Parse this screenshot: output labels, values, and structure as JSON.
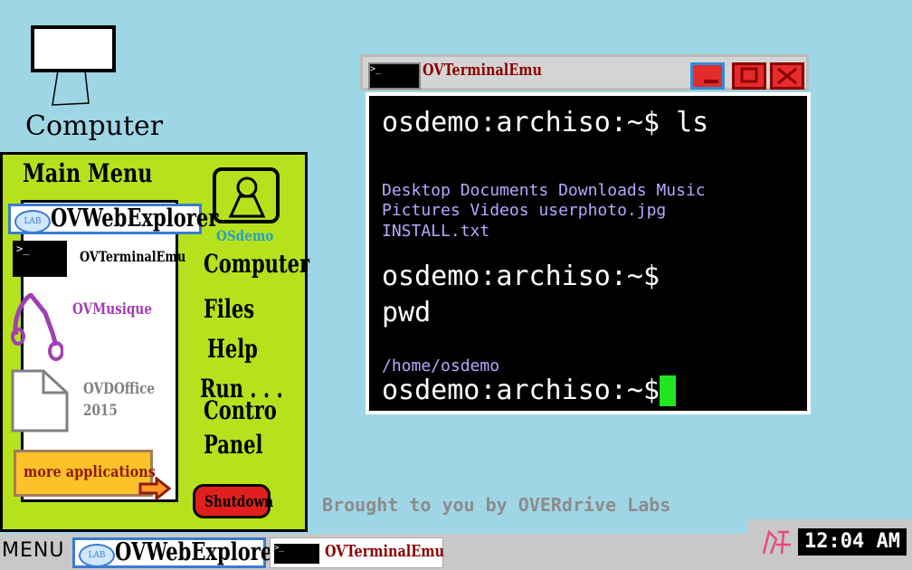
{
  "desktop": {
    "computer_label": "Computer"
  },
  "main_menu": {
    "title": "Main Menu",
    "pinned_app": "OVWebExplorer",
    "apps": [
      {
        "label": "OVTerminalEmu",
        "icon": "terminal-icon",
        "color": "#000000"
      },
      {
        "label": "OVMusique",
        "icon": "music-note-icon",
        "color": "#a040b0"
      },
      {
        "label_line1": "OVDOffice",
        "label_line2": "2015",
        "icon": "document-icon",
        "color": "#808080"
      }
    ],
    "more_apps": "more applications",
    "os_name": "OSdemo",
    "nav": [
      "Computer",
      "Files",
      "Help",
      "Run . . .",
      "Contro",
      "Panel"
    ],
    "shutdown": "Shutdown"
  },
  "terminal": {
    "title": "OVTerminalEmu",
    "icon_text": ">_",
    "lines": [
      "osdemo:archiso:~$ ls",
      "Desktop Documents Downloads Music",
      "Pictures Videos userphoto.jpg",
      "INSTALL.txt",
      "osdemo:archiso:~$",
      "pwd",
      "/home/osdemo",
      "osdemo:archiso:~$"
    ]
  },
  "credit": "Brought to you by OVERdrive Labs",
  "taskbar": {
    "start": "MENU",
    "tasks": [
      "OVWebExplorer",
      "OVTerminalEmu"
    ],
    "clock": "12:04 AM"
  },
  "colors": {
    "desktop_bg": "#9fd6e6",
    "menu_bg": "#b5e21d",
    "terminal_bg": "#000000",
    "cursor": "#1fe61f",
    "accent_red": "#e52b2b"
  }
}
